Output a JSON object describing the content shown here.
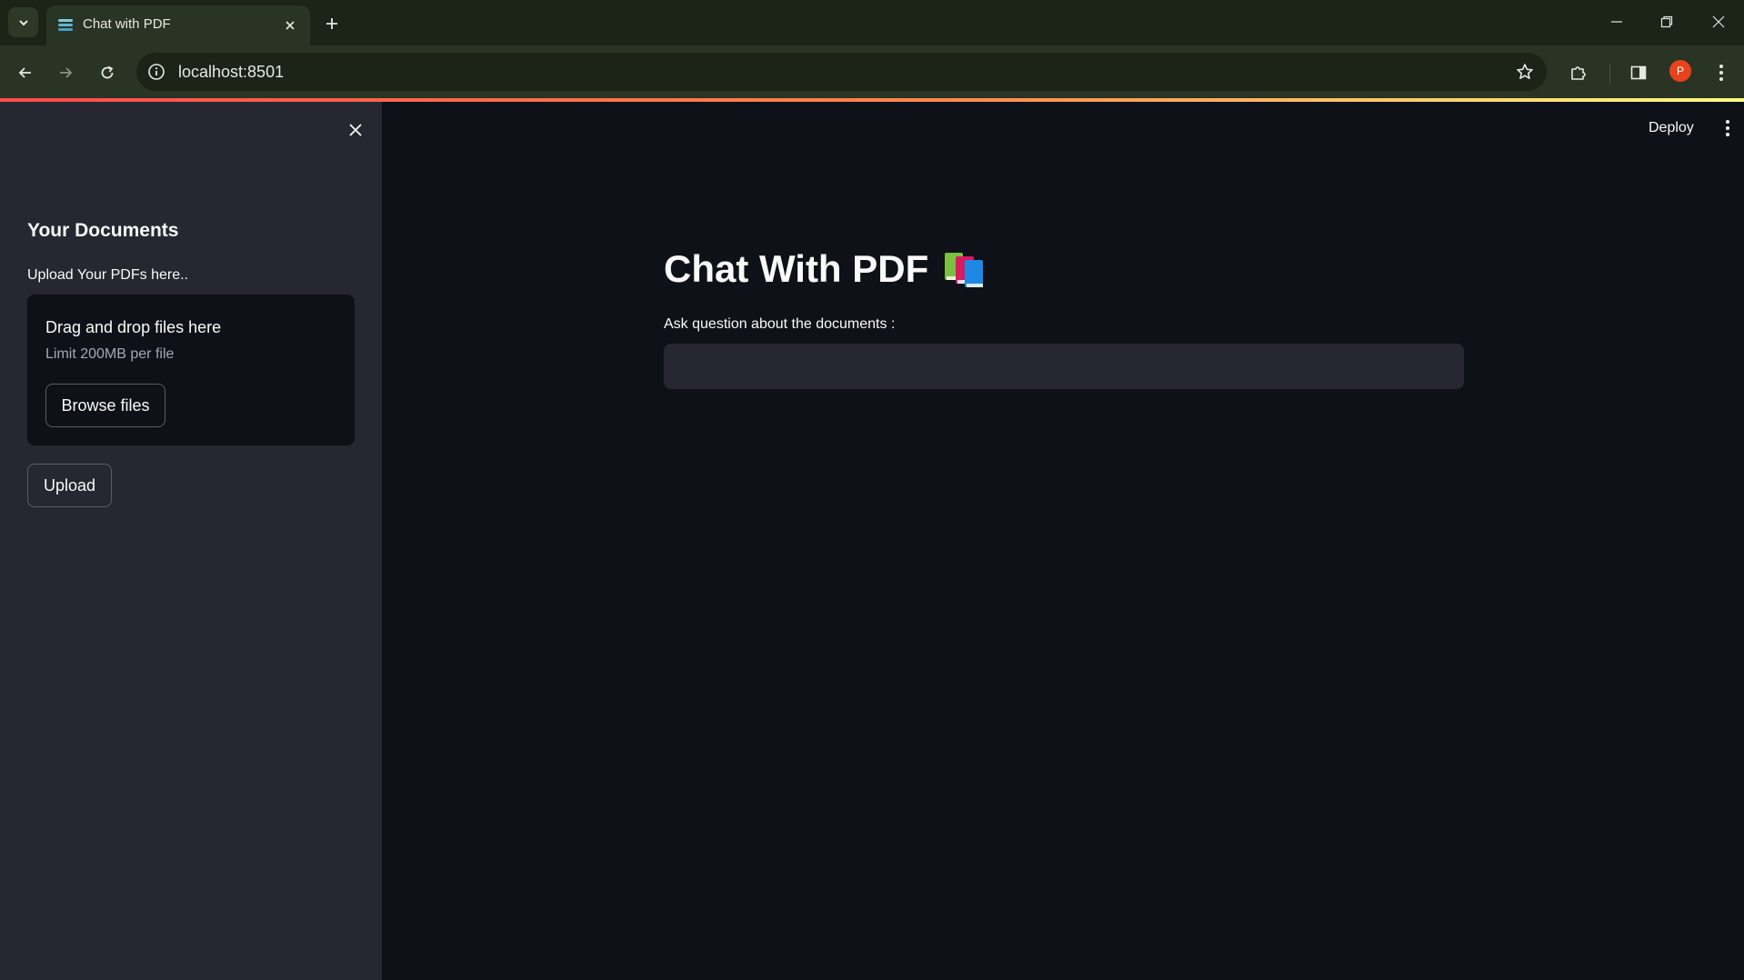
{
  "browser": {
    "tab_title": "Chat with PDF",
    "url": "localhost:8501",
    "profile_initial": "P",
    "colors": {
      "frame": "#1b2416",
      "toolbar": "#2a3424",
      "profile": "#e8431c"
    }
  },
  "app": {
    "header": {
      "deploy_label": "Deploy"
    },
    "sidebar": {
      "heading": "Your Documents",
      "uploader_label": "Upload Your PDFs here..",
      "dropzone_title": "Drag and drop files here",
      "dropzone_limit": "Limit 200MB per file",
      "browse_label": "Browse files",
      "upload_label": "Upload"
    },
    "main": {
      "title": "Chat With PDF",
      "title_icon": "books-emoji-icon",
      "question_label": "Ask question about the documents :",
      "question_value": ""
    },
    "colors": {
      "background": "#0e1117",
      "sidebar": "#262730",
      "text": "#fafafa",
      "muted": "#a3a8b8",
      "accent_gradient": [
        "#ff4b4b",
        "#fffd80"
      ]
    }
  }
}
